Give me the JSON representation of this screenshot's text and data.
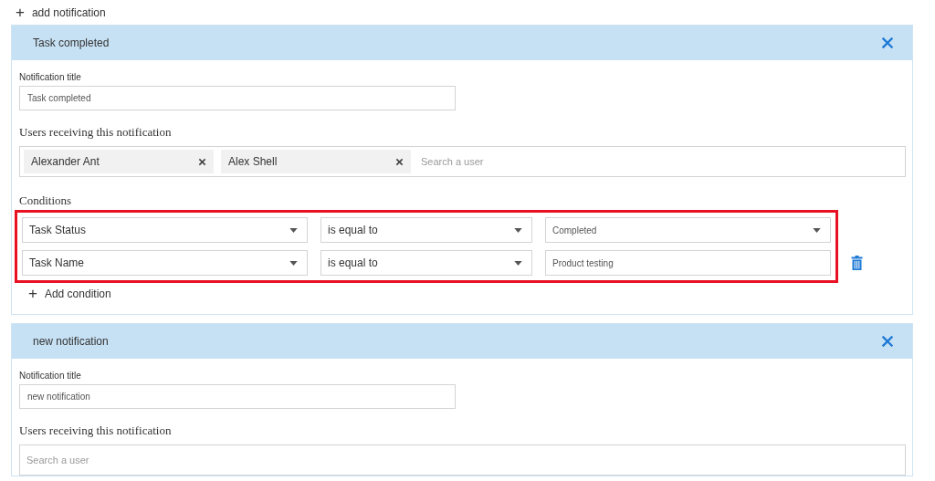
{
  "add_notification": {
    "icon": "+",
    "label": "add notification"
  },
  "notifications": [
    {
      "header": "Task completed",
      "title_label": "Notification title",
      "title_value": "Task completed",
      "users_label": "Users receiving this notification",
      "users": [
        {
          "name": "Alexander Ant"
        },
        {
          "name": "Alex Shell"
        }
      ],
      "user_search_placeholder": "Search a user",
      "conditions_label": "Conditions",
      "highlighted": true,
      "conditions": [
        {
          "field": "Task Status",
          "operator": "is equal to",
          "value": "Completed",
          "kind": "select"
        },
        {
          "field": "Task Name",
          "operator": "is equal to",
          "value": "Product testing",
          "kind": "text"
        }
      ],
      "add_condition": {
        "icon": "+",
        "label": "Add condition"
      }
    },
    {
      "header": "new notification",
      "title_label": "Notification title",
      "title_value": "new notification",
      "users_label": "Users receiving this notification",
      "user_search_placeholder": "Search a user"
    }
  ]
}
